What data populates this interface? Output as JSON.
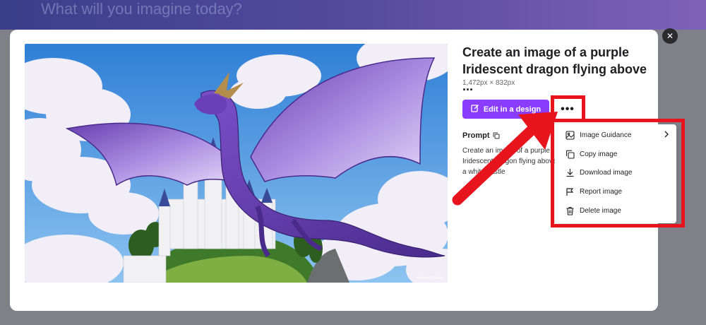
{
  "background": {
    "heading": "What will you imagine today?"
  },
  "modal": {
    "title": "Create an image of a purple Iridescent dragon flying above ...",
    "dimensions": "1,472px × 832px",
    "edit_button": "Edit in a design",
    "more_button": "•••",
    "prompt_label": "Prompt",
    "prompt_text": "Create an image of a purple Iridescent dragon flying above a white castle",
    "watermark": "made with Canva"
  },
  "menu": {
    "items": [
      {
        "label": "Image Guidance",
        "icon": "image-icon",
        "has_submenu": true
      },
      {
        "label": "Copy image",
        "icon": "copy-icon"
      },
      {
        "label": "Download image",
        "icon": "download-icon"
      },
      {
        "label": "Report image",
        "icon": "flag-icon"
      },
      {
        "label": "Delete image",
        "icon": "trash-icon"
      }
    ]
  },
  "colors": {
    "accent": "#8b3dff",
    "annotation": "#e8141d",
    "close_button": "#2b2b2f"
  }
}
